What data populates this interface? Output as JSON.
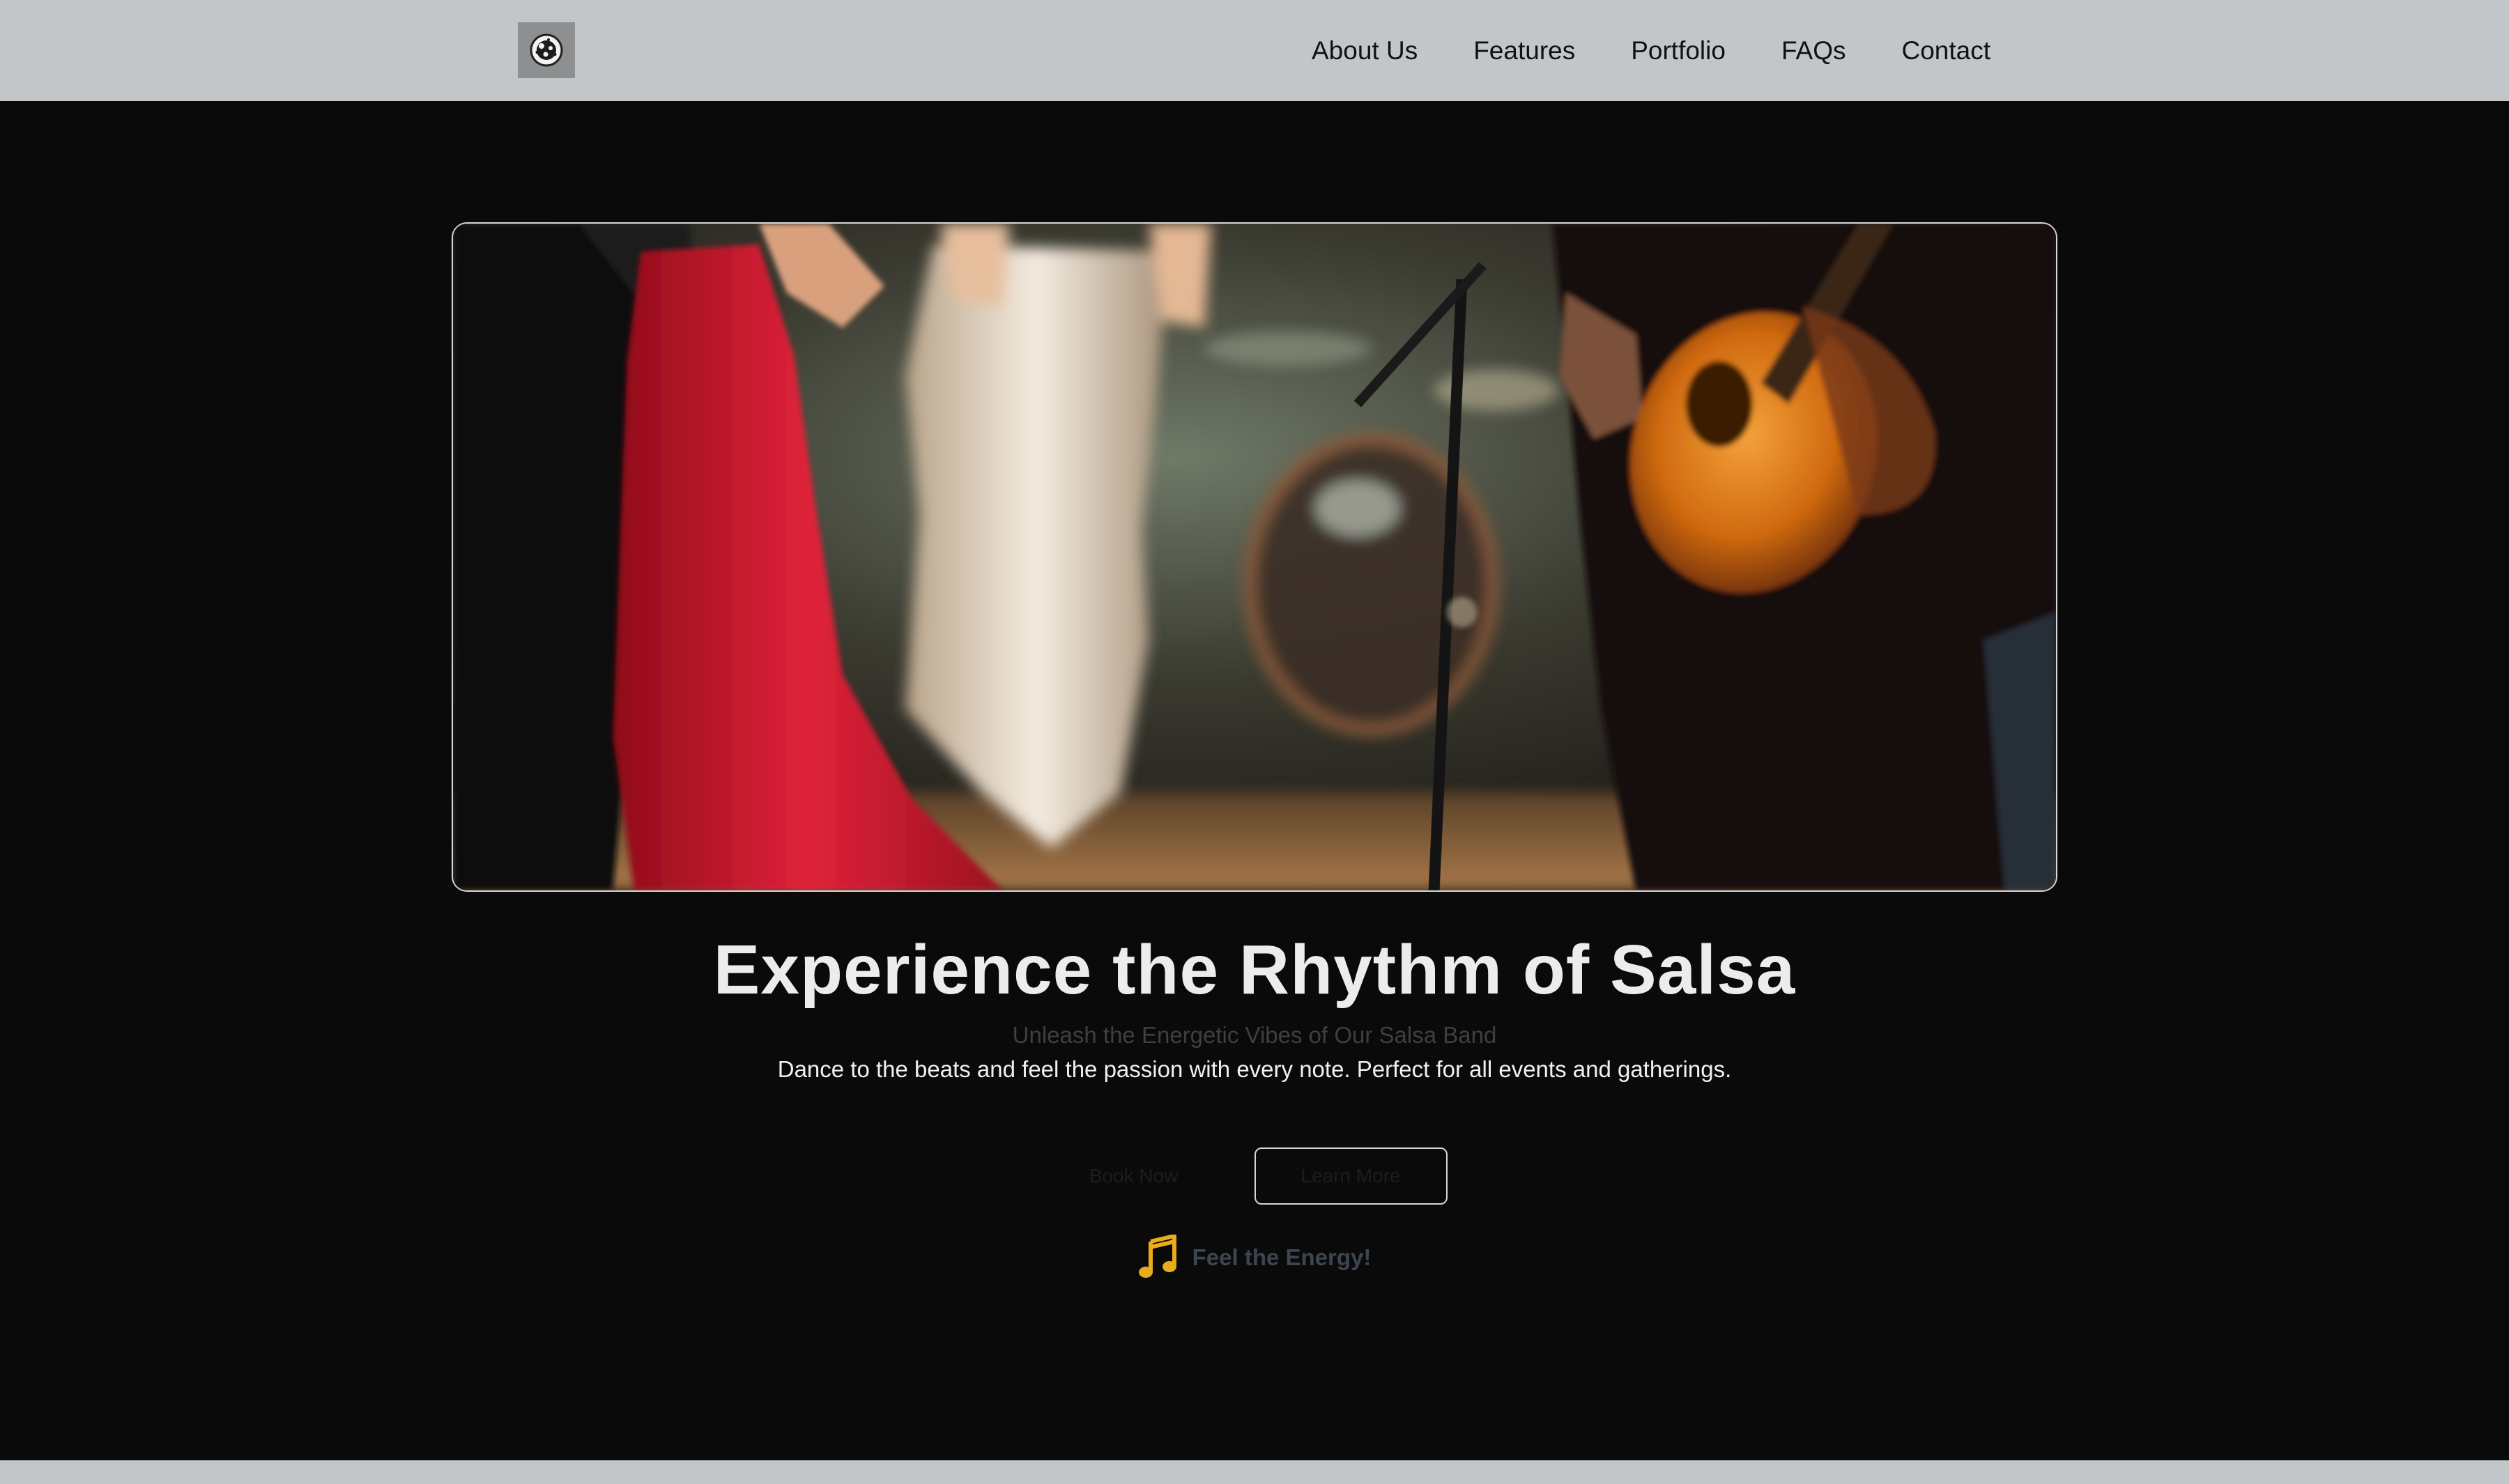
{
  "nav": {
    "logo_icon": "disco-ball-icon",
    "links": [
      "About Us",
      "Features",
      "Portfolio",
      "FAQs",
      "Contact"
    ]
  },
  "hero": {
    "image_description": "",
    "title": "Experience the Rhythm of Salsa",
    "subtitle": "Unleash the Energetic Vibes of Our Salsa Band",
    "description": "Dance to the beats and feel the passion with every note. Perfect for all events and gatherings.",
    "primary_button": "Book Now",
    "secondary_button": "Learn More",
    "tagline_icon": "music-note-icon",
    "tagline": "Feel the Energy!"
  },
  "colors": {
    "background": "#0a0a0a",
    "navbar": "#c3c6c8",
    "accent": "#e8ac1c"
  }
}
